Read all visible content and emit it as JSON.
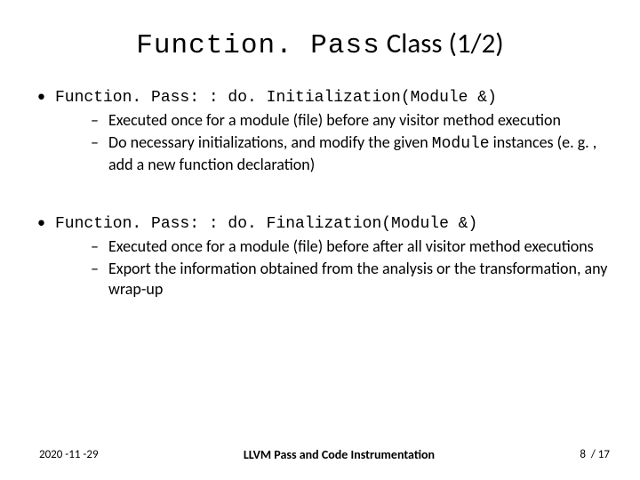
{
  "title": {
    "mono": "Function. Pass",
    "rest": " Class (1/2)"
  },
  "block1": {
    "heading": "Function. Pass: : do. Initialization(Module &)",
    "sub1": "Executed once for a module (file) before any visitor method execution",
    "sub2_a": "Do necessary initializations, and modify the given ",
    "sub2_mono": "Module",
    "sub2_b": " instances (e. g. , add a new function declaration)"
  },
  "block2": {
    "heading": "Function. Pass: : do. Finalization(Module &)",
    "sub1": "Executed once for a module (file) before after all visitor method executions",
    "sub2": "Export the information obtained from the analysis or the transformation, any wrap-up"
  },
  "footer": {
    "date": "2020 -11 -29",
    "center": "LLVM Pass and Code Instrumentation",
    "page": "8  / 17"
  }
}
